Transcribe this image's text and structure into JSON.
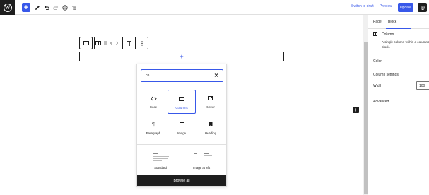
{
  "topbar": {
    "switch_to_draft": "Switch to draft",
    "preview": "Preview",
    "update": "Update",
    "add_symbol": "+"
  },
  "canvas": {
    "appender_symbol": "+"
  },
  "inserter": {
    "search_value": "co",
    "blocks": [
      {
        "label": "Code",
        "icon": "code-icon"
      },
      {
        "label": "Columns",
        "icon": "columns-icon",
        "selected": true
      },
      {
        "label": "Cover",
        "icon": "cover-icon"
      },
      {
        "label": "Paragraph",
        "icon": "paragraph-icon"
      },
      {
        "label": "Image",
        "icon": "image-icon"
      },
      {
        "label": "Heading",
        "icon": "heading-icon"
      }
    ],
    "patterns": [
      {
        "label": "Standard"
      },
      {
        "label": "Image at left"
      }
    ],
    "browse_all": "Browse all"
  },
  "sidebar": {
    "tabs": [
      "Page",
      "Block"
    ],
    "active_tab": "Block",
    "block_title": "Column",
    "block_description": "A single column within a columns block.",
    "sections": {
      "color": "Color",
      "column_settings": "Column settings",
      "width_label": "Width",
      "width_value": "100",
      "advanced": "Advanced"
    }
  },
  "colors": {
    "accent": "#3858e9",
    "dark": "#1e1e1e"
  }
}
